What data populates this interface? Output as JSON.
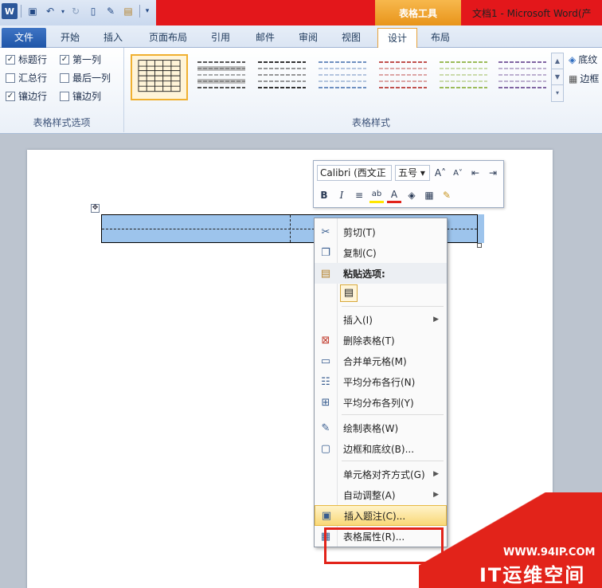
{
  "window": {
    "table_tools_label": "表格工具",
    "doc_title": "文档1 - Microsoft Word(产"
  },
  "quick_access": {
    "app_icon": "W",
    "icons": [
      "word-app-icon",
      "save-icon",
      "undo-icon",
      "redo-icon",
      "new-document-icon",
      "format-painter-icon",
      "picture-icon",
      "customize-qat-icon"
    ]
  },
  "tabs": [
    "文件",
    "开始",
    "插入",
    "页面布局",
    "引用",
    "邮件",
    "审阅",
    "视图",
    "设计",
    "布局"
  ],
  "ribbon": {
    "options": [
      {
        "label": "标题行",
        "checked": true
      },
      {
        "label": "第一列",
        "checked": true
      },
      {
        "label": "汇总行",
        "checked": false
      },
      {
        "label": "最后一列",
        "checked": false
      },
      {
        "label": "镶边行",
        "checked": true
      },
      {
        "label": "镶边列",
        "checked": false
      }
    ],
    "options_group_label": "表格样式选项",
    "styles_group_label": "表格样式",
    "shading_label": "底纹",
    "borders_label": "边框",
    "style_colors": [
      "#555555",
      "#333333",
      "#6d8fc0",
      "#c0504d",
      "#9bbb59",
      "#8064a2",
      "#4bacc6"
    ]
  },
  "mini_toolbar": {
    "font": "Calibri (西文正",
    "size": "五号",
    "row2": [
      "B",
      "I",
      "≡",
      "ab",
      "A",
      "◈",
      "▦",
      "✎"
    ]
  },
  "context_menu": {
    "cut": "剪切(T)",
    "copy": "复制(C)",
    "paste_options": "粘贴选项:",
    "insert": "插入(I)",
    "delete_table": "删除表格(T)",
    "merge_cells": "合并单元格(M)",
    "distribute_rows": "平均分布各行(N)",
    "distribute_columns": "平均分布各列(Y)",
    "draw_table": "绘制表格(W)",
    "borders_shading": "边框和底纹(B)...",
    "cell_alignment": "单元格对齐方式(G)",
    "autofit": "自动调整(A)",
    "insert_caption": "插入题注(C)...",
    "table_properties": "表格属性(R)..."
  },
  "watermark": {
    "url": "WWW.94IP.COM",
    "name": "IT运维空间"
  }
}
